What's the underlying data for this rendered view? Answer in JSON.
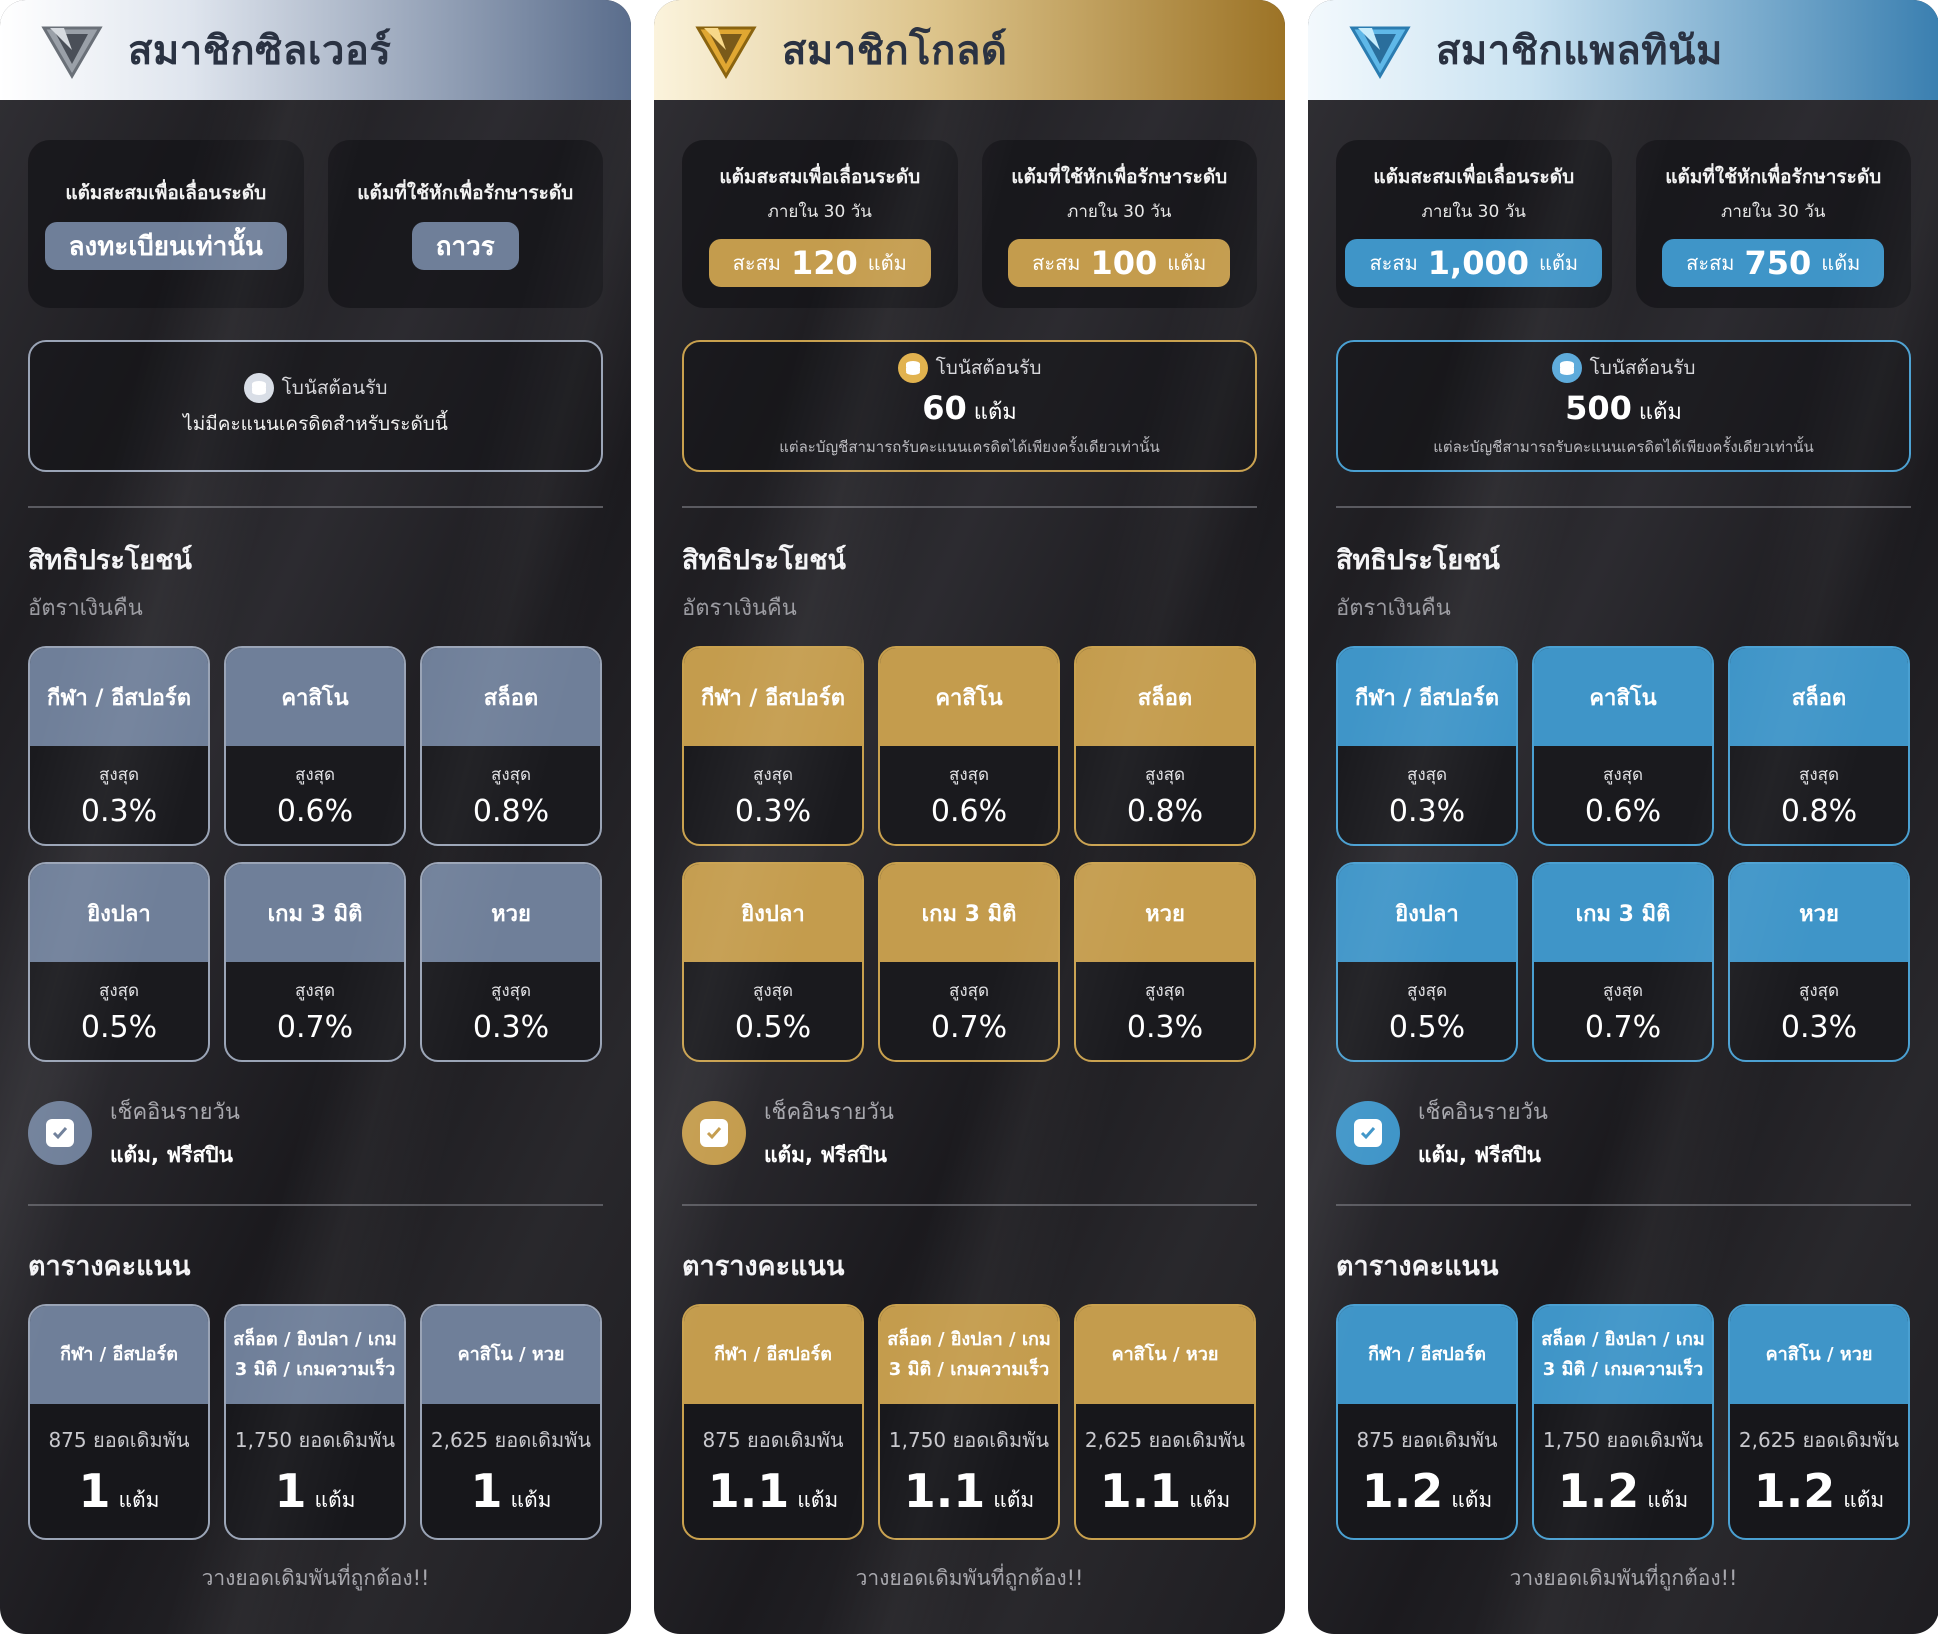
{
  "colors": {
    "silver": {
      "accent": "#6f7f99",
      "header_start": "#ffffff",
      "header_end": "#5a6d8c",
      "border": "#9aa4b6",
      "coin": "#d8dde6"
    },
    "gold": {
      "accent": "#c49c4d",
      "header_start": "#faf0d6",
      "header_end": "#a17727",
      "border": "#c9a14e",
      "coin": "#e0b04a"
    },
    "platinum": {
      "accent": "#3f95c8",
      "header_start": "#f0f7fc",
      "header_end": "#3a7fb0",
      "border": "#4aa0d2",
      "coin": "#5aa9da"
    }
  },
  "tiers": [
    {
      "key": "silver",
      "logo_icon": "silver-v-diamond",
      "title": "สมาชิกซิลเวอร์",
      "upgrade": {
        "label": "แต้มสะสมเพื่อเลื่อนระดับ",
        "value": "ลงทะเบียนเท่านั้น"
      },
      "maintain": {
        "label": "แต้มที่ใช้หักเพื่อรักษาระดับ",
        "value": "ถาวร"
      },
      "bonus": {
        "title": "โบนัสต้อนรับ",
        "note": "ไม่มีคะแนนเครดิตสำหรับระดับนี้"
      },
      "benefits": {
        "title": "สิทธิประโยชน์",
        "subtitle": "อัตราเงินคืน"
      },
      "cashback": [
        {
          "game": "กีฬา / อีสปอร์ต",
          "label": "สูงสุด",
          "value": "0.3%"
        },
        {
          "game": "คาสิโน",
          "label": "สูงสุด",
          "value": "0.6%"
        },
        {
          "game": "สล็อต",
          "label": "สูงสุด",
          "value": "0.8%"
        },
        {
          "game": "ยิงปลา",
          "label": "สูงสุด",
          "value": "0.5%"
        },
        {
          "game": "เกม 3 มิติ",
          "label": "สูงสุด",
          "value": "0.7%"
        },
        {
          "game": "หวย",
          "label": "สูงสุด",
          "value": "0.3%"
        }
      ],
      "checkin": {
        "title": "เช็คอินรายวัน",
        "desc": "แต้ม, ฟรีสปิน"
      },
      "score_title": "ตารางคะแนน",
      "score": [
        {
          "head": "กีฬา / อีสปอร์ต",
          "bet": "875 ยอดเดิมพัน",
          "points": "1",
          "unit": "แต้ม"
        },
        {
          "head": "สล็อต / ยิงปลา / เกม 3 มิติ / เกมความเร็ว",
          "bet": "1,750 ยอดเดิมพัน",
          "points": "1",
          "unit": "แต้ม"
        },
        {
          "head": "คาสิโน / หวย",
          "bet": "2,625 ยอดเดิมพัน",
          "points": "1",
          "unit": "แต้ม"
        }
      ],
      "footer": "วางยอดเดิมพันที่ถูกต้อง!!"
    },
    {
      "key": "gold",
      "logo_icon": "gold-v-diamond",
      "title": "สมาชิกโกลด์",
      "upgrade": {
        "label": "แต้มสะสมเพื่อเลื่อนระดับ",
        "sub": "ภายใน 30 วัน",
        "prefix": "สะสม",
        "amount": "120",
        "unit": "แต้ม"
      },
      "maintain": {
        "label": "แต้มที่ใช้หักเพื่อรักษาระดับ",
        "sub": "ภายใน 30 วัน",
        "prefix": "สะสม",
        "amount": "100",
        "unit": "แต้ม"
      },
      "bonus": {
        "title": "โบนัสต้อนรับ",
        "amount": "60",
        "unit": "แต้ม",
        "note": "แต่ละบัญชีสามารถรับคะแนนเครดิตได้เพียงครั้งเดียวเท่านั้น"
      },
      "benefits": {
        "title": "สิทธิประโยชน์",
        "subtitle": "อัตราเงินคืน"
      },
      "cashback": [
        {
          "game": "กีฬา / อีสปอร์ต",
          "label": "สูงสุด",
          "value": "0.3%"
        },
        {
          "game": "คาสิโน",
          "label": "สูงสุด",
          "value": "0.6%"
        },
        {
          "game": "สล็อต",
          "label": "สูงสุด",
          "value": "0.8%"
        },
        {
          "game": "ยิงปลา",
          "label": "สูงสุด",
          "value": "0.5%"
        },
        {
          "game": "เกม 3 มิติ",
          "label": "สูงสุด",
          "value": "0.7%"
        },
        {
          "game": "หวย",
          "label": "สูงสุด",
          "value": "0.3%"
        }
      ],
      "checkin": {
        "title": "เช็คอินรายวัน",
        "desc": "แต้ม, ฟรีสปิน"
      },
      "score_title": "ตารางคะแนน",
      "score": [
        {
          "head": "กีฬา / อีสปอร์ต",
          "bet": "875 ยอดเดิมพัน",
          "points": "1.1",
          "unit": "แต้ม"
        },
        {
          "head": "สล็อต / ยิงปลา / เกม 3 มิติ / เกมความเร็ว",
          "bet": "1,750 ยอดเดิมพัน",
          "points": "1.1",
          "unit": "แต้ม"
        },
        {
          "head": "คาสิโน / หวย",
          "bet": "2,625 ยอดเดิมพัน",
          "points": "1.1",
          "unit": "แต้ม"
        }
      ],
      "footer": "วางยอดเดิมพันที่ถูกต้อง!!"
    },
    {
      "key": "platinum",
      "logo_icon": "platinum-v-diamond",
      "title": "สมาชิกแพลทินัม",
      "upgrade": {
        "label": "แต้มสะสมเพื่อเลื่อนระดับ",
        "sub": "ภายใน 30 วัน",
        "prefix": "สะสม",
        "amount": "1,000",
        "unit": "แต้ม"
      },
      "maintain": {
        "label": "แต้มที่ใช้หักเพื่อรักษาระดับ",
        "sub": "ภายใน 30 วัน",
        "prefix": "สะสม",
        "amount": "750",
        "unit": "แต้ม"
      },
      "bonus": {
        "title": "โบนัสต้อนรับ",
        "amount": "500",
        "unit": "แต้ม",
        "note": "แต่ละบัญชีสามารถรับคะแนนเครดิตได้เพียงครั้งเดียวเท่านั้น"
      },
      "benefits": {
        "title": "สิทธิประโยชน์",
        "subtitle": "อัตราเงินคืน"
      },
      "cashback": [
        {
          "game": "กีฬา / อีสปอร์ต",
          "label": "สูงสุด",
          "value": "0.3%"
        },
        {
          "game": "คาสิโน",
          "label": "สูงสุด",
          "value": "0.6%"
        },
        {
          "game": "สล็อต",
          "label": "สูงสุด",
          "value": "0.8%"
        },
        {
          "game": "ยิงปลา",
          "label": "สูงสุด",
          "value": "0.5%"
        },
        {
          "game": "เกม 3 มิติ",
          "label": "สูงสุด",
          "value": "0.7%"
        },
        {
          "game": "หวย",
          "label": "สูงสุด",
          "value": "0.3%"
        }
      ],
      "checkin": {
        "title": "เช็คอินรายวัน",
        "desc": "แต้ม, ฟรีสปิน"
      },
      "score_title": "ตารางคะแนน",
      "score": [
        {
          "head": "กีฬา / อีสปอร์ต",
          "bet": "875 ยอดเดิมพัน",
          "points": "1.2",
          "unit": "แต้ม"
        },
        {
          "head": "สล็อต / ยิงปลา / เกม 3 มิติ / เกมความเร็ว",
          "bet": "1,750 ยอดเดิมพัน",
          "points": "1.2",
          "unit": "แต้ม"
        },
        {
          "head": "คาสิโน / หวย",
          "bet": "2,625 ยอดเดิมพัน",
          "points": "1.2",
          "unit": "แต้ม"
        }
      ],
      "footer": "วางยอดเดิมพันที่ถูกต้อง!!"
    }
  ]
}
